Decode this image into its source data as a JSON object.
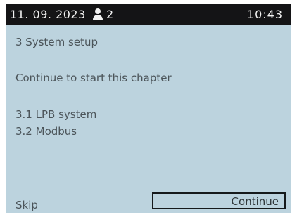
{
  "status_bar": {
    "date": "11. 09. 2023",
    "user_icon": "person-icon",
    "user_count": "2",
    "time": "10:43"
  },
  "main": {
    "chapter_title": "3 System setup",
    "hint": "Continue to start this chapter",
    "items": [
      {
        "label": "3.1 LPB system"
      },
      {
        "label": "3.2 Modbus"
      }
    ]
  },
  "footer": {
    "skip_label": "Skip",
    "continue_label": "Continue"
  },
  "colors": {
    "screen_background": "#bcd3de",
    "status_bar_background": "#141416",
    "text": "#4b5459"
  }
}
